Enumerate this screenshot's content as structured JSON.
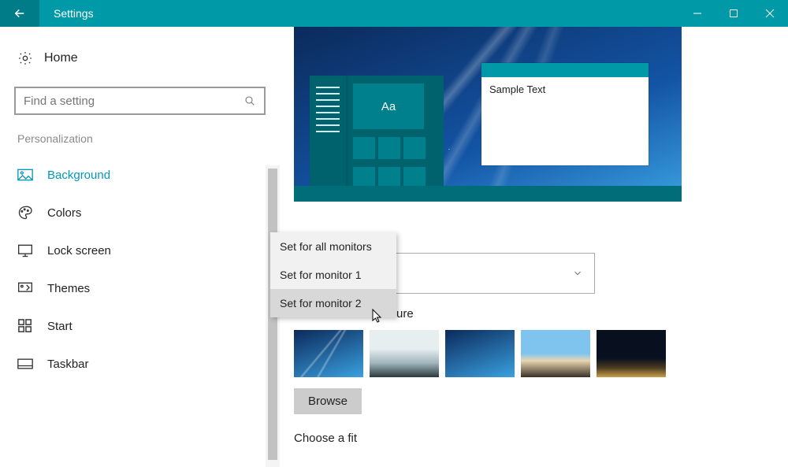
{
  "titlebar": {
    "title": "Settings"
  },
  "home": {
    "label": "Home"
  },
  "search": {
    "placeholder": "Find a setting"
  },
  "section": {
    "label": "Personalization"
  },
  "nav": [
    {
      "label": "Background"
    },
    {
      "label": "Colors"
    },
    {
      "label": "Lock screen"
    },
    {
      "label": "Themes"
    },
    {
      "label": "Start"
    },
    {
      "label": "Taskbar"
    }
  ],
  "preview": {
    "tile_text": "Aa",
    "sample_text": "Sample Text"
  },
  "context_menu": [
    "Set for all monitors",
    "Set for monitor 1",
    "Set for monitor 2"
  ],
  "main": {
    "choose_picture_label": "ure",
    "browse_label": "Browse",
    "choose_fit_label": "Choose a fit"
  }
}
